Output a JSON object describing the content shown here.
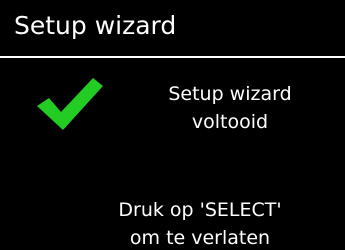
{
  "header": {
    "title": "Setup wizard"
  },
  "status": {
    "icon": "checkmark-icon",
    "icon_color": "#22cc22",
    "line1": "Setup wizard",
    "line2": "voltooid"
  },
  "hint": {
    "line1": "Druk op 'SELECT'",
    "line2": "om te verlaten"
  },
  "colors": {
    "background": "#000000",
    "text": "#ffffff",
    "divider": "#ffffff"
  }
}
